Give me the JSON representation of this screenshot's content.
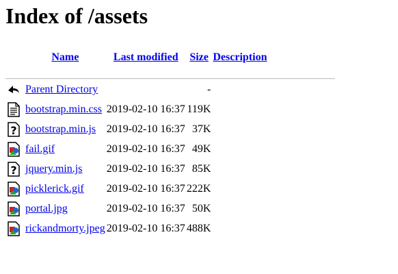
{
  "page": {
    "title": "Index of /assets"
  },
  "columns": {
    "name": "Name",
    "last_modified": "Last modified",
    "size": "Size",
    "description": "Description"
  },
  "rows": [
    {
      "icon": "back-arrow-icon",
      "name": "Parent Directory",
      "modified": "",
      "size": "-",
      "description": ""
    },
    {
      "icon": "text-file-icon",
      "name": "bootstrap.min.css",
      "modified": "2019-02-10 16:37",
      "size": "119K",
      "description": ""
    },
    {
      "icon": "unknown-file-icon",
      "name": "bootstrap.min.js",
      "modified": "2019-02-10 16:37",
      "size": "37K",
      "description": ""
    },
    {
      "icon": "image-file-icon",
      "name": "fail.gif",
      "modified": "2019-02-10 16:37",
      "size": "49K",
      "description": ""
    },
    {
      "icon": "unknown-file-icon",
      "name": "jquery.min.js",
      "modified": "2019-02-10 16:37",
      "size": "85K",
      "description": ""
    },
    {
      "icon": "image-file-icon",
      "name": "picklerick.gif",
      "modified": "2019-02-10 16:37",
      "size": "222K",
      "description": ""
    },
    {
      "icon": "image-file-icon",
      "name": "portal.jpg",
      "modified": "2019-02-10 16:37",
      "size": "50K",
      "description": ""
    },
    {
      "icon": "image-file-icon",
      "name": "rickandmorty.jpeg",
      "modified": "2019-02-10 16:37",
      "size": "488K",
      "description": ""
    }
  ],
  "colors": {
    "link": "#0000ee",
    "rule": "#c6c6c6"
  }
}
